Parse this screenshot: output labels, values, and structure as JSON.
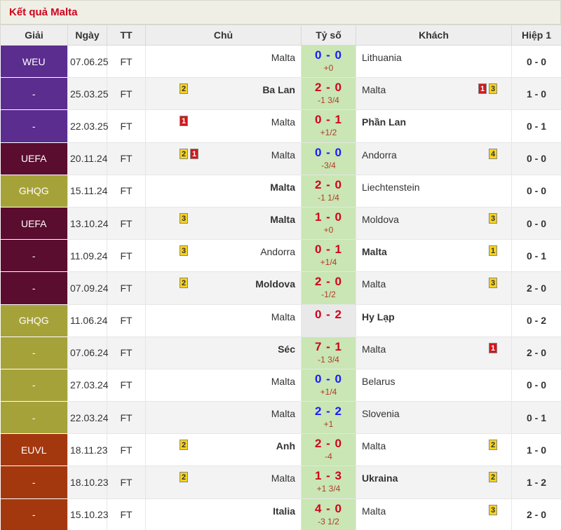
{
  "title": "Kết quả Malta",
  "headers": {
    "league": "Giải",
    "date": "Ngày",
    "status": "TT",
    "home": "Chủ",
    "score": "Tỷ số",
    "away": "Khách",
    "half": "Hiệp 1"
  },
  "colors": {
    "WEU": "#5b2d8e",
    "UEFA": "#5a0d2e",
    "GHQG": "#a6a23a",
    "EUVL": "#a3380f"
  },
  "rows": [
    {
      "league": "WEU",
      "color": "#5b2d8e",
      "date": "07.06.25",
      "status": "FT",
      "home": "Malta",
      "home_bold": false,
      "home_cards": [],
      "score": "0 - 0",
      "score_color": "blue",
      "score_bg": "green",
      "handicap": "+0",
      "away": "Lithuania",
      "away_bold": false,
      "away_cards": [],
      "half": "0 - 0"
    },
    {
      "league": "-",
      "color": "#5b2d8e",
      "date": "25.03.25",
      "status": "FT",
      "home": "Ba Lan",
      "home_bold": true,
      "home_cards": [
        {
          "t": "yellow",
          "n": "2"
        }
      ],
      "score": "2 - 0",
      "score_color": "red",
      "score_bg": "green",
      "handicap": "-1 3/4",
      "away": "Malta",
      "away_bold": false,
      "away_cards": [
        {
          "t": "red",
          "n": "1"
        },
        {
          "t": "yellow",
          "n": "3"
        }
      ],
      "half": "1 - 0"
    },
    {
      "league": "-",
      "color": "#5b2d8e",
      "date": "22.03.25",
      "status": "FT",
      "home": "Malta",
      "home_bold": false,
      "home_cards": [
        {
          "t": "red",
          "n": "1"
        }
      ],
      "score": "0 - 1",
      "score_color": "red",
      "score_bg": "green",
      "handicap": "+1/2",
      "away": "Phần Lan",
      "away_bold": true,
      "away_cards": [],
      "half": "0 - 1"
    },
    {
      "league": "UEFA",
      "color": "#5a0d2e",
      "date": "20.11.24",
      "status": "FT",
      "home": "Malta",
      "home_bold": false,
      "home_cards": [
        {
          "t": "yellow",
          "n": "2"
        },
        {
          "t": "red",
          "n": "1"
        }
      ],
      "score": "0 - 0",
      "score_color": "blue",
      "score_bg": "green",
      "handicap": "-3/4",
      "away": "Andorra",
      "away_bold": false,
      "away_cards": [
        {
          "t": "yellow",
          "n": "4"
        }
      ],
      "half": "0 - 0"
    },
    {
      "league": "GHQG",
      "color": "#a6a23a",
      "date": "15.11.24",
      "status": "FT",
      "home": "Malta",
      "home_bold": true,
      "home_cards": [],
      "score": "2 - 0",
      "score_color": "red",
      "score_bg": "green",
      "handicap": "-1 1/4",
      "away": "Liechtenstein",
      "away_bold": false,
      "away_cards": [],
      "half": "0 - 0"
    },
    {
      "league": "UEFA",
      "color": "#5a0d2e",
      "date": "13.10.24",
      "status": "FT",
      "home": "Malta",
      "home_bold": true,
      "home_cards": [
        {
          "t": "yellow",
          "n": "3"
        }
      ],
      "score": "1 - 0",
      "score_color": "red",
      "score_bg": "green",
      "handicap": "+0",
      "away": "Moldova",
      "away_bold": false,
      "away_cards": [
        {
          "t": "yellow",
          "n": "3"
        }
      ],
      "half": "0 - 0"
    },
    {
      "league": "-",
      "color": "#5a0d2e",
      "date": "11.09.24",
      "status": "FT",
      "home": "Andorra",
      "home_bold": false,
      "home_cards": [
        {
          "t": "yellow",
          "n": "3"
        }
      ],
      "score": "0 - 1",
      "score_color": "red",
      "score_bg": "green",
      "handicap": "+1/4",
      "away": "Malta",
      "away_bold": true,
      "away_cards": [
        {
          "t": "yellow",
          "n": "1"
        }
      ],
      "half": "0 - 1"
    },
    {
      "league": "-",
      "color": "#5a0d2e",
      "date": "07.09.24",
      "status": "FT",
      "home": "Moldova",
      "home_bold": true,
      "home_cards": [
        {
          "t": "yellow",
          "n": "2"
        }
      ],
      "score": "2 - 0",
      "score_color": "red",
      "score_bg": "green",
      "handicap": "-1/2",
      "away": "Malta",
      "away_bold": false,
      "away_cards": [
        {
          "t": "yellow",
          "n": "3"
        }
      ],
      "half": "2 - 0"
    },
    {
      "league": "GHQG",
      "color": "#a6a23a",
      "date": "11.06.24",
      "status": "FT",
      "home": "Malta",
      "home_bold": false,
      "home_cards": [],
      "score": "0 - 2",
      "score_color": "red",
      "score_bg": "gray",
      "handicap": "",
      "away": "Hy Lạp",
      "away_bold": true,
      "away_cards": [],
      "half": "0 - 2"
    },
    {
      "league": "-",
      "color": "#a6a23a",
      "date": "07.06.24",
      "status": "FT",
      "home": "Séc",
      "home_bold": true,
      "home_cards": [],
      "score": "7 - 1",
      "score_color": "red",
      "score_bg": "green",
      "handicap": "-1 3/4",
      "away": "Malta",
      "away_bold": false,
      "away_cards": [
        {
          "t": "red",
          "n": "1"
        }
      ],
      "half": "2 - 0"
    },
    {
      "league": "-",
      "color": "#a6a23a",
      "date": "27.03.24",
      "status": "FT",
      "home": "Malta",
      "home_bold": false,
      "home_cards": [],
      "score": "0 - 0",
      "score_color": "blue",
      "score_bg": "green",
      "handicap": "+1/4",
      "away": "Belarus",
      "away_bold": false,
      "away_cards": [],
      "half": "0 - 0"
    },
    {
      "league": "-",
      "color": "#a6a23a",
      "date": "22.03.24",
      "status": "FT",
      "home": "Malta",
      "home_bold": false,
      "home_cards": [],
      "score": "2 - 2",
      "score_color": "blue",
      "score_bg": "green",
      "handicap": "+1",
      "away": "Slovenia",
      "away_bold": false,
      "away_cards": [],
      "half": "0 - 1"
    },
    {
      "league": "EUVL",
      "color": "#a3380f",
      "date": "18.11.23",
      "status": "FT",
      "home": "Anh",
      "home_bold": true,
      "home_cards": [
        {
          "t": "yellow",
          "n": "2"
        }
      ],
      "score": "2 - 0",
      "score_color": "red",
      "score_bg": "green",
      "handicap": "-4",
      "away": "Malta",
      "away_bold": false,
      "away_cards": [
        {
          "t": "yellow",
          "n": "2"
        }
      ],
      "half": "1 - 0"
    },
    {
      "league": "-",
      "color": "#a3380f",
      "date": "18.10.23",
      "status": "FT",
      "home": "Malta",
      "home_bold": false,
      "home_cards": [
        {
          "t": "yellow",
          "n": "2"
        }
      ],
      "score": "1 - 3",
      "score_color": "red",
      "score_bg": "green",
      "handicap": "+1 3/4",
      "away": "Ukraina",
      "away_bold": true,
      "away_cards": [
        {
          "t": "yellow",
          "n": "2"
        }
      ],
      "half": "1 - 2"
    },
    {
      "league": "-",
      "color": "#a3380f",
      "date": "15.10.23",
      "status": "FT",
      "home": "Italia",
      "home_bold": true,
      "home_cards": [],
      "score": "4 - 0",
      "score_color": "red",
      "score_bg": "green",
      "handicap": "-3 1/2",
      "away": "Malta",
      "away_bold": false,
      "away_cards": [
        {
          "t": "yellow",
          "n": "3"
        }
      ],
      "half": "2 - 0"
    }
  ]
}
